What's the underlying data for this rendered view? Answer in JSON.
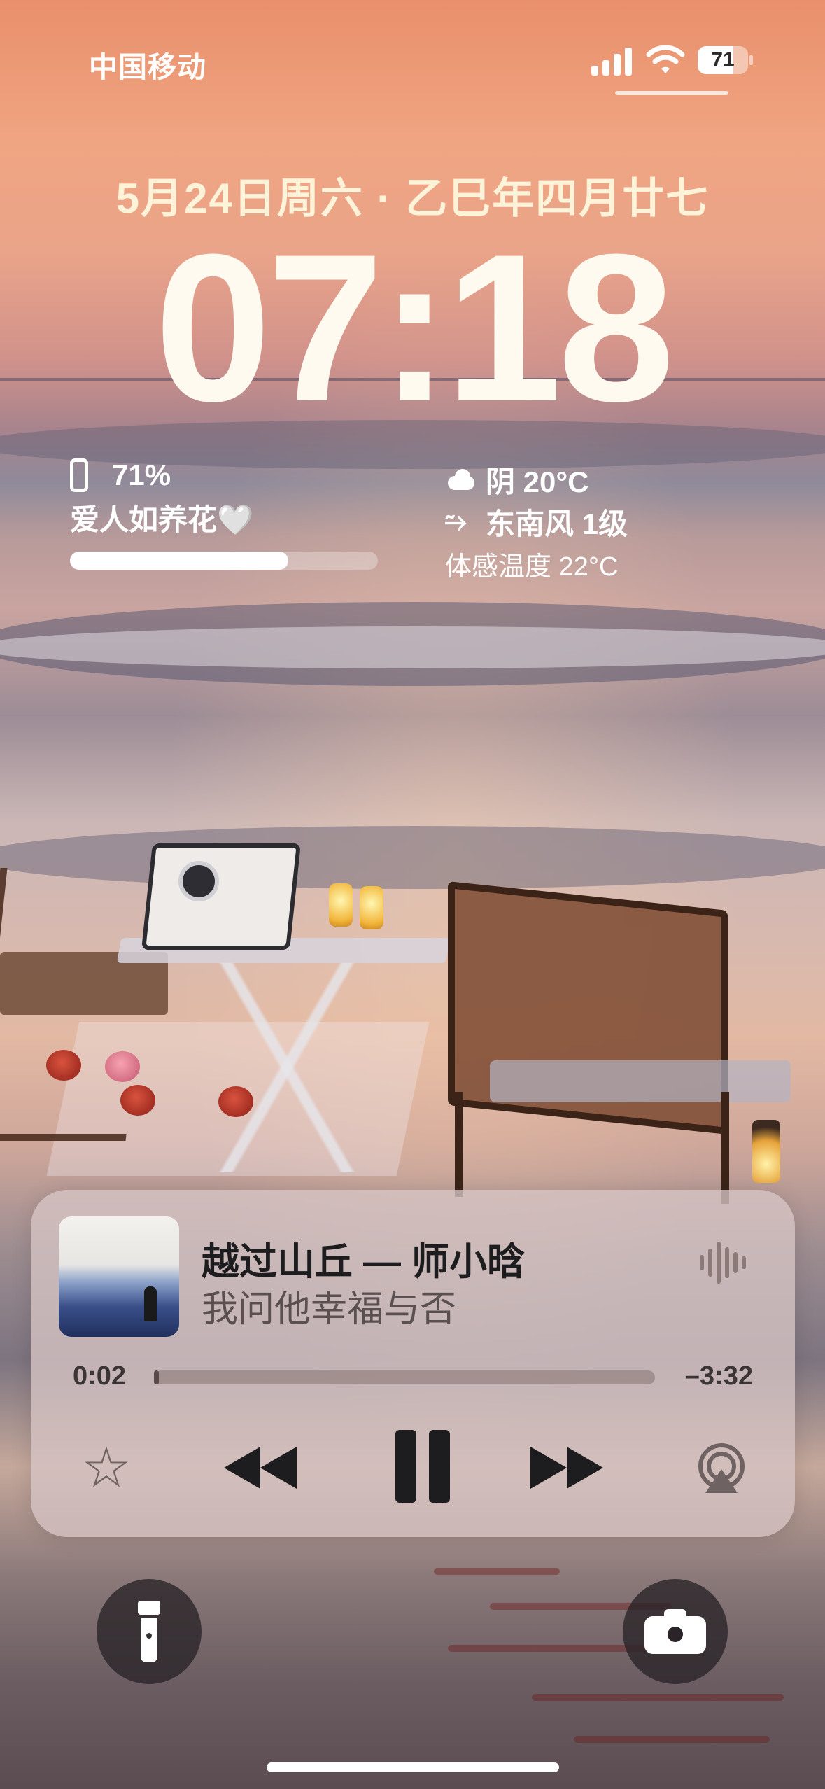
{
  "status_bar": {
    "carrier": "中国移动",
    "battery_level": "71",
    "battery_fraction": 0.71
  },
  "lock_screen": {
    "date": "5月24日周六 · 乙巳年四月廿七",
    "time": "07:18"
  },
  "battery_widget": {
    "percent": "71%",
    "caption": "爱人如养花",
    "caption_emoji": "🤍",
    "level_fraction": 0.71
  },
  "weather_widget": {
    "condition": "阴 20°C",
    "wind": "东南风 1级",
    "feels_like": "体感温度 22°C",
    "icons": [
      "cloud-icon",
      "wind-icon"
    ]
  },
  "now_playing": {
    "title": "越过山丘 — 师小晗",
    "subtitle": "我问他幸福与否",
    "elapsed": "0:02",
    "remaining": "–3:32",
    "progress_fraction": 0.01,
    "controls": [
      "favorite",
      "rewind",
      "pause",
      "fast-forward",
      "airplay"
    ]
  },
  "colors": {
    "player_bg": "#d6c4c4",
    "control_dark": "#1d1d1f",
    "date_text": "#fdf3d8"
  }
}
